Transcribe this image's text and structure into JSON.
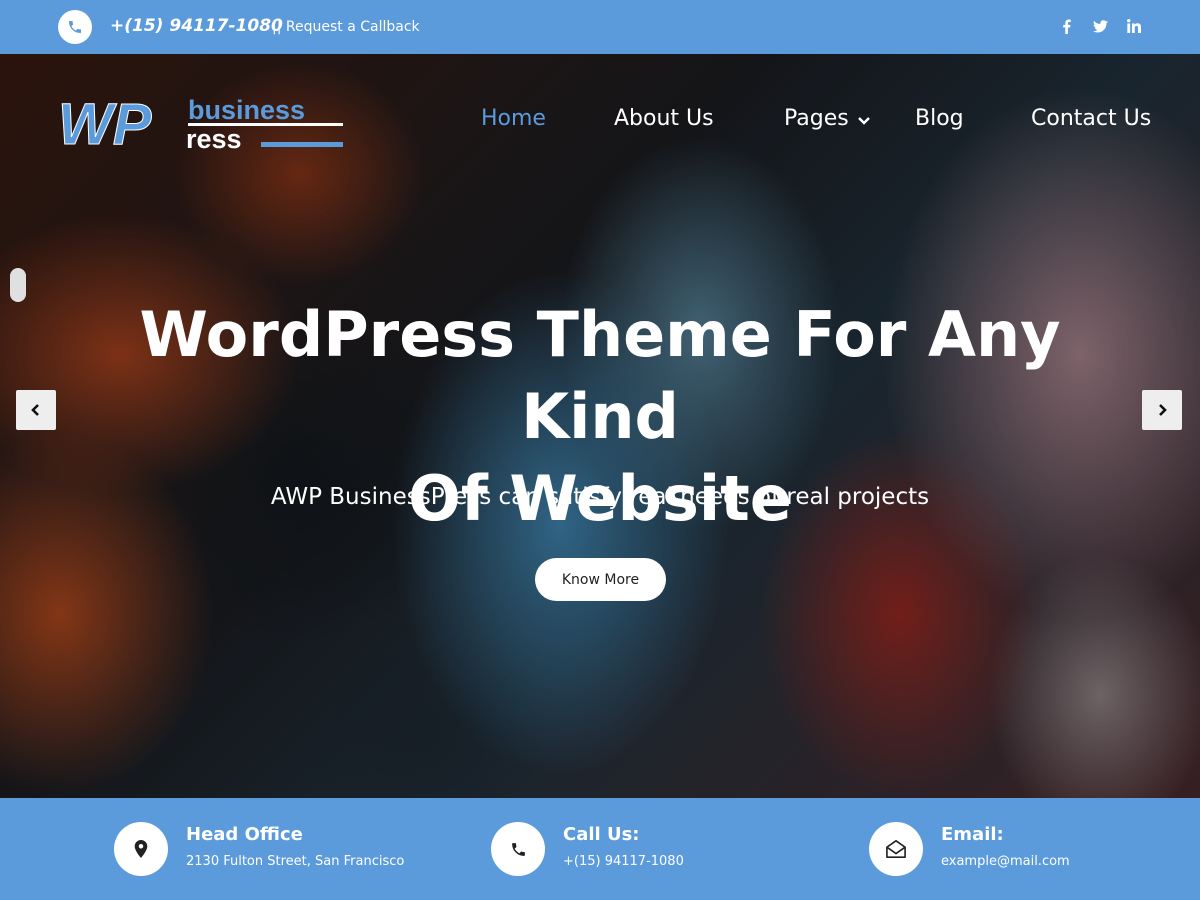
{
  "topbar": {
    "phone": "+(15) 94117-1080",
    "callback": "|| Request a Callback",
    "social_icons": [
      "facebook-icon",
      "twitter-icon",
      "linkedin-icon"
    ],
    "background": "#5b9bdc"
  },
  "logo": {
    "wp": "WP",
    "business": "business",
    "ress": "ress"
  },
  "nav": {
    "items": [
      {
        "label": "Home",
        "active": true
      },
      {
        "label": "About Us",
        "active": false
      },
      {
        "label": "Pages",
        "active": false,
        "has_dropdown": true
      },
      {
        "label": "Blog",
        "active": false
      },
      {
        "label": "Contact Us",
        "active": false
      }
    ],
    "active_color": "#5b9bdc"
  },
  "hero": {
    "title_line1": "WordPress Theme For Any Kind",
    "title_line2": "Of Website",
    "subtitle": "AWP BusinessPress can satisfy real needs of real projects",
    "cta_label": "Know More"
  },
  "info": [
    {
      "title": "Head Office",
      "text": "2130 Fulton Street, San Francisco",
      "icon": "map-pin-icon"
    },
    {
      "title": "Call Us:",
      "text": "+(15) 94117-1080",
      "icon": "phone-icon"
    },
    {
      "title": "Email:",
      "text": "example@mail.com",
      "icon": "envelope-icon"
    }
  ]
}
